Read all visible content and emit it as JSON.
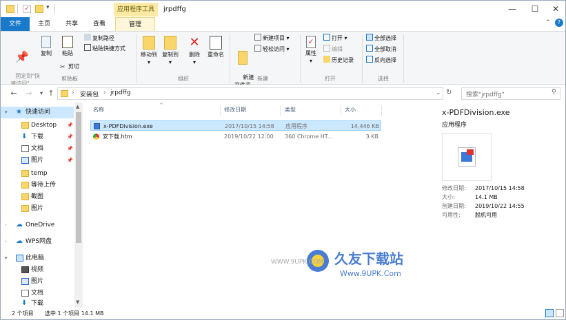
{
  "titlebar": {
    "tools_tab": "应用程序工具",
    "window_title": "jrpdffg",
    "minimize": "—",
    "maximize": "☐",
    "close": "✕"
  },
  "ribbon_tabs": {
    "file": "文件",
    "home": "主页",
    "share": "共享",
    "view": "查看",
    "manage": "管理"
  },
  "ribbon": {
    "pin_quick": "固定到\"快\n速访问\"",
    "copy": "复制",
    "paste": "粘贴",
    "copy_path": "复制路径",
    "paste_shortcut": "粘贴快捷方式",
    "cut": "剪切",
    "clipboard_group": "剪贴板",
    "move_to": "移动到",
    "copy_to": "复制到",
    "delete": "删除",
    "rename": "重命名",
    "organize_group": "组织",
    "new_folder": "新建\n文件夹",
    "new_item": "新建项目",
    "easy_access": "轻松访问",
    "new_group": "新建",
    "properties": "属性",
    "open": "打开",
    "edit": "编辑",
    "history": "历史记录",
    "open_group": "打开",
    "select_all": "全部选择",
    "select_none": "全部取消",
    "invert_selection": "反向选择",
    "select_group": "选择"
  },
  "address": {
    "crumbs": [
      "安装包",
      "jrpdffg"
    ],
    "search_placeholder": "搜索\"jrpdffg\""
  },
  "navpane": {
    "items": [
      {
        "label": "快速访问",
        "icon": "star-icon",
        "pinned": false
      },
      {
        "label": "Desktop",
        "icon": "folder-icon",
        "pinned": true
      },
      {
        "label": "下载",
        "icon": "download-icon",
        "pinned": true
      },
      {
        "label": "文档",
        "icon": "document-icon",
        "pinned": true
      },
      {
        "label": "图片",
        "icon": "picture-icon",
        "pinned": true
      },
      {
        "label": "temp",
        "icon": "folder-icon",
        "pinned": false
      },
      {
        "label": "等待上传",
        "icon": "folder-icon",
        "pinned": false
      },
      {
        "label": "截图",
        "icon": "folder-icon",
        "pinned": false
      },
      {
        "label": "图片",
        "icon": "folder-icon",
        "pinned": false
      },
      {
        "label": "OneDrive",
        "icon": "cloud-icon",
        "pinned": false
      },
      {
        "label": "WPS网盘",
        "icon": "cloud-icon",
        "pinned": false
      },
      {
        "label": "此电脑",
        "icon": "computer-icon",
        "pinned": false
      },
      {
        "label": "视频",
        "icon": "video-icon",
        "pinned": false
      },
      {
        "label": "图片",
        "icon": "picture-icon",
        "pinned": false
      },
      {
        "label": "文档",
        "icon": "document-icon",
        "pinned": false
      },
      {
        "label": "下载",
        "icon": "download-icon",
        "pinned": false
      }
    ]
  },
  "filelist": {
    "columns": [
      "名称",
      "修改日期",
      "类型",
      "大小"
    ],
    "rows": [
      {
        "name": "x-PDFDivision.exe",
        "date": "2017/10/15 14:58",
        "type": "应用程序",
        "size": "14,446 KB",
        "selected": true
      },
      {
        "name": "安下载.htm",
        "date": "2019/10/22 12:00",
        "type": "360 Chrome HT...",
        "size": "3 KB",
        "selected": false
      }
    ]
  },
  "details": {
    "filename": "x-PDFDivision.exe",
    "filetype": "应用程序",
    "rows": [
      {
        "k": "修改日期:",
        "v": "2017/10/15 14:58"
      },
      {
        "k": "大小:",
        "v": "14.1 MB"
      },
      {
        "k": "创建日期:",
        "v": "2019/10/22 14:55"
      },
      {
        "k": "可用性:",
        "v": "脱机可用"
      }
    ]
  },
  "status": {
    "count": "2 个项目",
    "selected": "选中 1 个项目  14.1 MB"
  },
  "watermark": {
    "url": "WWW.9UPK.COM",
    "brand": "久友下载站",
    "site": "Www.9UPK.Com"
  },
  "colors": {
    "accent": "#1979ca",
    "selection": "#cce8ff",
    "tools": "#fbeaa6"
  }
}
